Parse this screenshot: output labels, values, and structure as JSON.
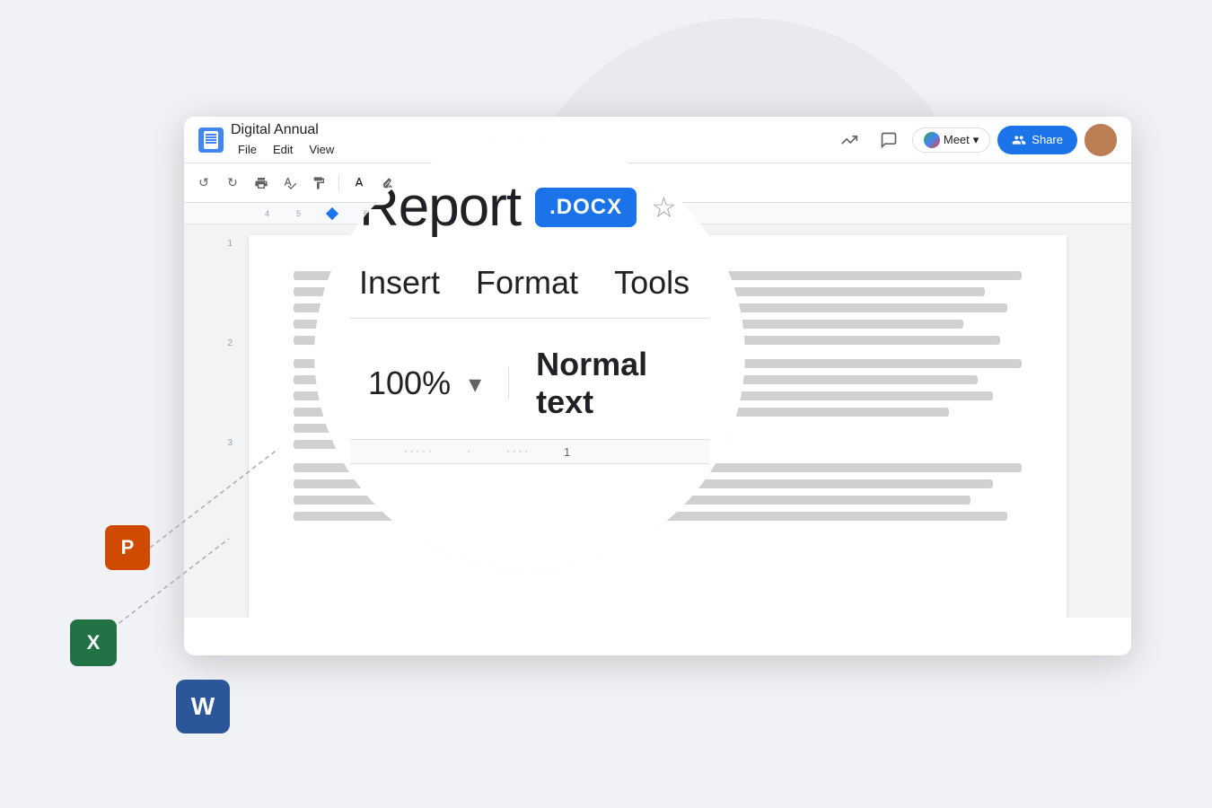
{
  "background": {
    "circle_color": "#e8eaed"
  },
  "browser": {
    "title_bar": {
      "doc_title": "Digital Annual",
      "menu_items": [
        "File",
        "Edit",
        "View"
      ]
    },
    "toolbar": {
      "undo_label": "↺",
      "redo_label": "↻",
      "print_label": "🖨",
      "spell_label": "✓",
      "format_label": "⚙"
    },
    "share_btn_label": "Share",
    "meet_btn_label": "Meet"
  },
  "magnify": {
    "title": "Report",
    "docx_badge": ".DOCX",
    "menu_items": [
      "Insert",
      "Format",
      "Tools"
    ],
    "zoom": "100%",
    "normal_text": "Normal text",
    "ruler_num": "1"
  },
  "app_icons": {
    "powerpoint": "P",
    "excel": "X",
    "word": "W"
  }
}
